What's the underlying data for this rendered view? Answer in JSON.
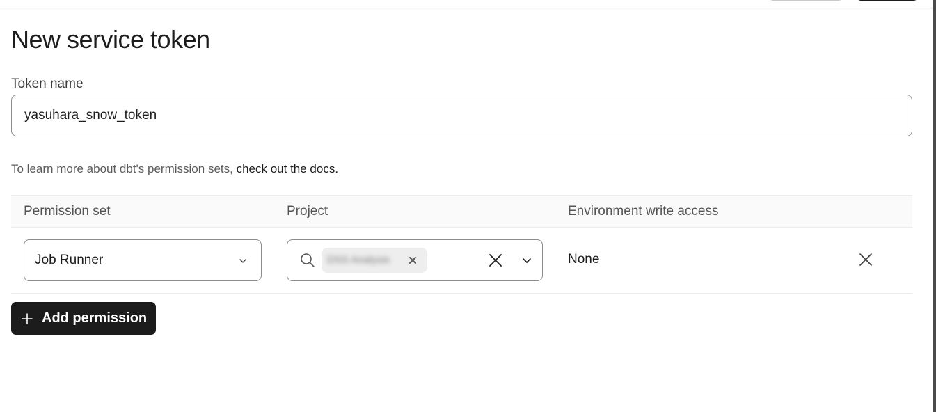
{
  "page": {
    "title": "New service token"
  },
  "token": {
    "label": "Token name",
    "value": "yasuhara_snow_token"
  },
  "help": {
    "text": "To learn more about dbt's permission sets,",
    "link": "check out the docs."
  },
  "table": {
    "headers": {
      "permission_set": "Permission set",
      "project": "Project",
      "env_access": "Environment write access"
    },
    "rows": [
      {
        "permission_set": "Job Runner",
        "project_chip": "DSS Analysis",
        "env_access": "None"
      }
    ]
  },
  "actions": {
    "add_permission": "Add permission"
  },
  "icons": {
    "search": "search-icon",
    "chip_remove": "close-icon",
    "clear": "close-icon",
    "dropdown": "chevron-down-icon",
    "row_remove": "close-icon",
    "add": "plus-icon"
  },
  "colors": {
    "primary_button": "#1c1c1c",
    "border": "#8c8c8c",
    "header_bg": "#fafafa"
  }
}
